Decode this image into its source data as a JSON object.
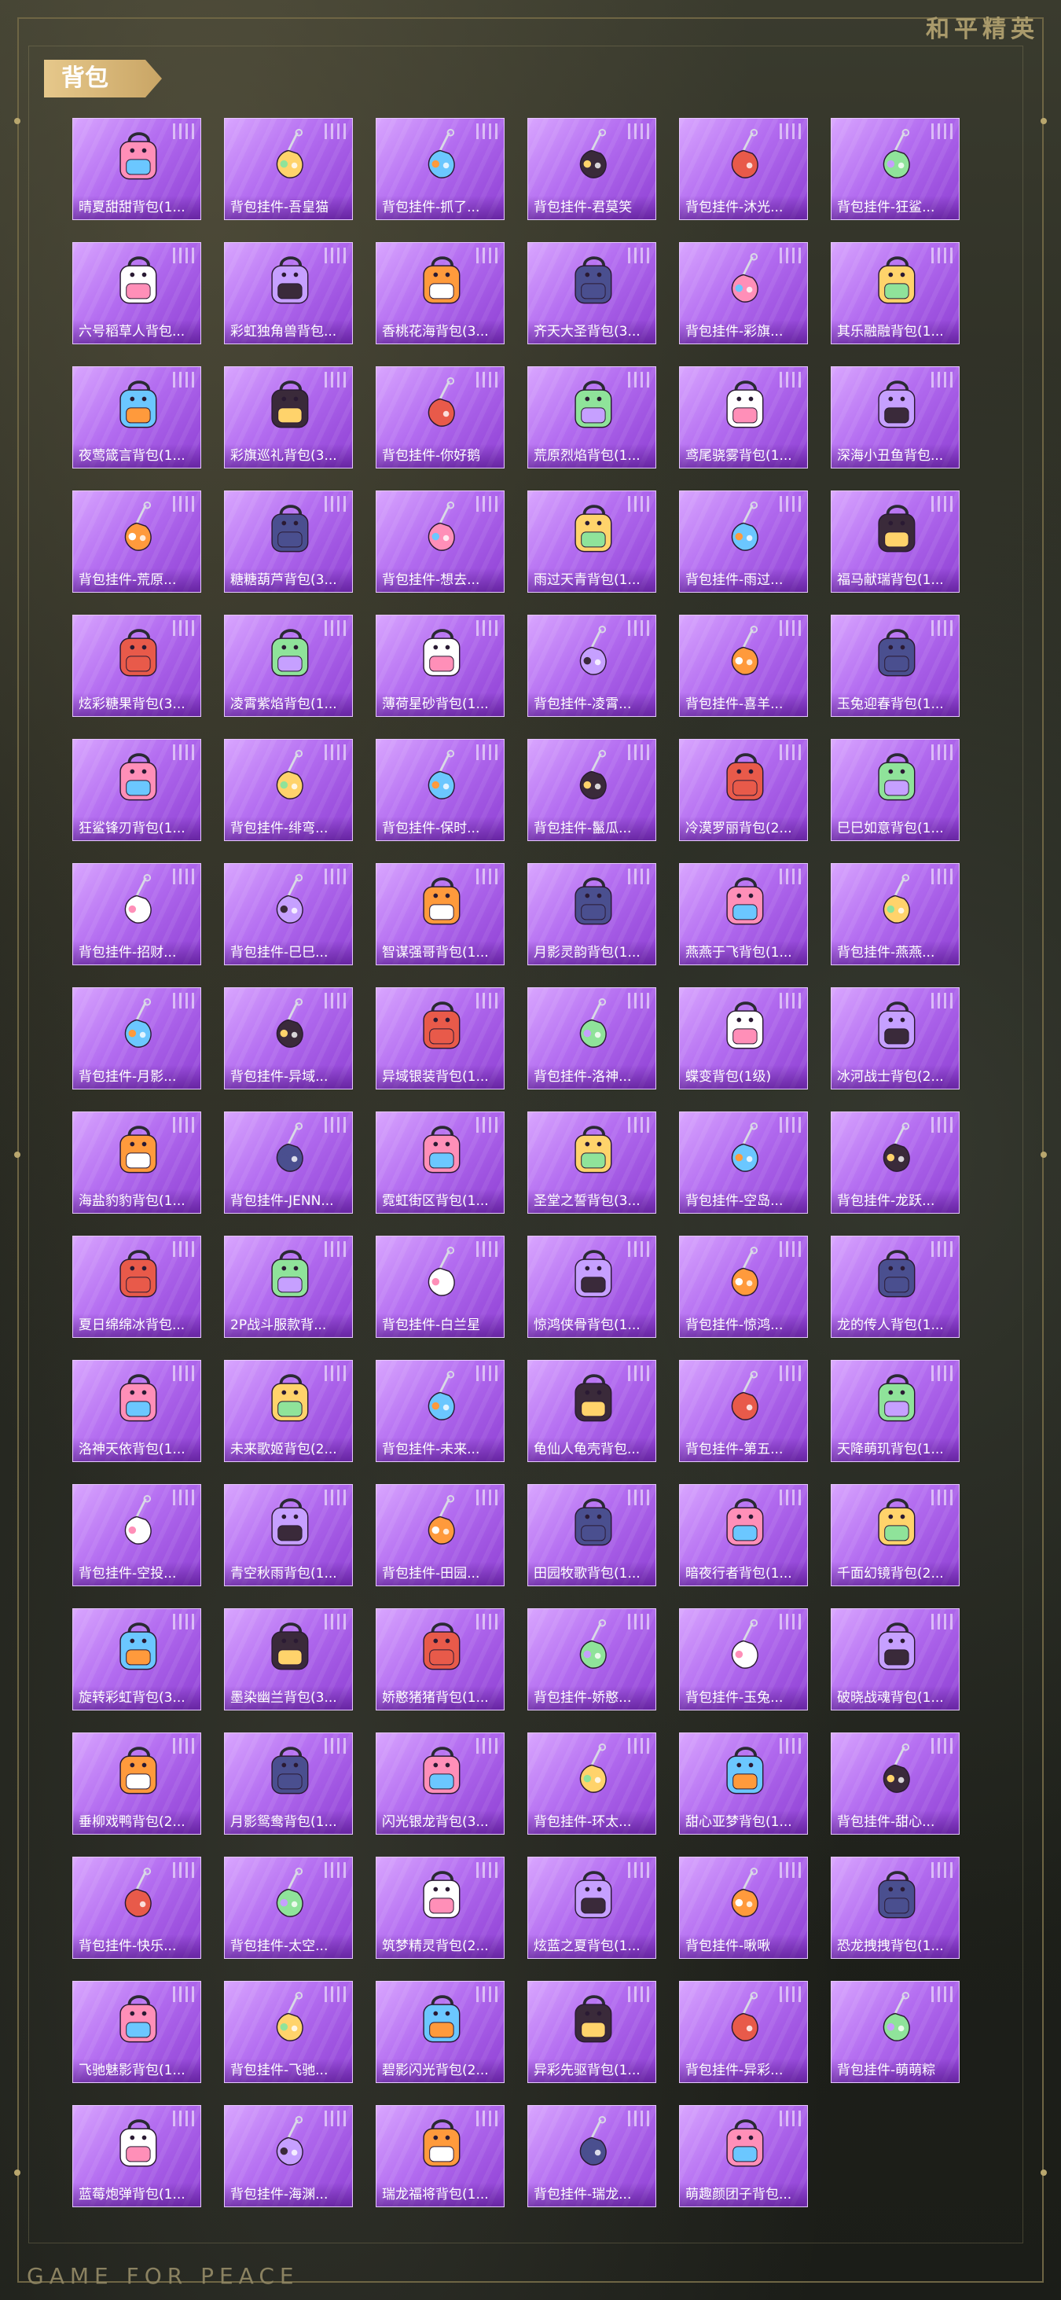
{
  "brand": "和平精英",
  "footer": "GAME FOR PEACE",
  "section_title": "背包",
  "items": [
    {
      "label": "晴夏甜甜背包(1...",
      "icon": "backpack-icon"
    },
    {
      "label": "背包挂件-吾皇猫",
      "icon": "charm-icon"
    },
    {
      "label": "背包挂件-抓了...",
      "icon": "charm-icon"
    },
    {
      "label": "背包挂件-君莫笑",
      "icon": "charm-icon"
    },
    {
      "label": "背包挂件-沐光...",
      "icon": "charm-icon"
    },
    {
      "label": "背包挂件-狂鲨...",
      "icon": "charm-icon"
    },
    {
      "label": "六号稻草人背包...",
      "icon": "backpack-icon"
    },
    {
      "label": "彩虹独角兽背包...",
      "icon": "backpack-icon"
    },
    {
      "label": "香桃花海背包(3...",
      "icon": "backpack-icon"
    },
    {
      "label": "齐天大圣背包(3...",
      "icon": "backpack-icon"
    },
    {
      "label": "背包挂件-彩旗...",
      "icon": "charm-icon"
    },
    {
      "label": "其乐融融背包(1...",
      "icon": "backpack-icon"
    },
    {
      "label": "夜莺箴言背包(1...",
      "icon": "backpack-icon"
    },
    {
      "label": "彩旗巡礼背包(3...",
      "icon": "backpack-icon"
    },
    {
      "label": "背包挂件-你好鹅",
      "icon": "charm-icon"
    },
    {
      "label": "荒原烈焰背包(1...",
      "icon": "backpack-icon"
    },
    {
      "label": "鸢尾骁雾背包(1...",
      "icon": "backpack-icon"
    },
    {
      "label": "深海小丑鱼背包...",
      "icon": "backpack-icon"
    },
    {
      "label": "背包挂件-荒原...",
      "icon": "charm-icon"
    },
    {
      "label": "糖糖葫芦背包(3...",
      "icon": "backpack-icon"
    },
    {
      "label": "背包挂件-想去...",
      "icon": "charm-icon"
    },
    {
      "label": "雨过天青背包(1...",
      "icon": "backpack-icon"
    },
    {
      "label": "背包挂件-雨过...",
      "icon": "charm-icon"
    },
    {
      "label": "福马献瑞背包(1...",
      "icon": "backpack-icon"
    },
    {
      "label": "炫彩糖果背包(3...",
      "icon": "backpack-icon"
    },
    {
      "label": "凌霄紫焰背包(1...",
      "icon": "backpack-icon"
    },
    {
      "label": "薄荷星砂背包(1...",
      "icon": "backpack-icon"
    },
    {
      "label": "背包挂件-凌霄...",
      "icon": "charm-icon"
    },
    {
      "label": "背包挂件-喜羊...",
      "icon": "charm-icon"
    },
    {
      "label": "玉兔迎春背包(1...",
      "icon": "backpack-icon"
    },
    {
      "label": "狂鲨锋刃背包(1...",
      "icon": "backpack-icon"
    },
    {
      "label": "背包挂件-绯弯...",
      "icon": "charm-icon"
    },
    {
      "label": "背包挂件-保时...",
      "icon": "charm-icon"
    },
    {
      "label": "背包挂件-鬣瓜...",
      "icon": "charm-icon"
    },
    {
      "label": "冷漠罗丽背包(2...",
      "icon": "backpack-icon"
    },
    {
      "label": "巳巳如意背包(1...",
      "icon": "backpack-icon"
    },
    {
      "label": "背包挂件-招财...",
      "icon": "charm-icon"
    },
    {
      "label": "背包挂件-巳巳...",
      "icon": "charm-icon"
    },
    {
      "label": "智谋强哥背包(1...",
      "icon": "backpack-icon"
    },
    {
      "label": "月影灵韵背包(1...",
      "icon": "backpack-icon"
    },
    {
      "label": "燕燕于飞背包(1...",
      "icon": "backpack-icon"
    },
    {
      "label": "背包挂件-燕燕...",
      "icon": "charm-icon"
    },
    {
      "label": "背包挂件-月影...",
      "icon": "charm-icon"
    },
    {
      "label": "背包挂件-异域...",
      "icon": "charm-icon"
    },
    {
      "label": "异域银装背包(1...",
      "icon": "backpack-icon"
    },
    {
      "label": "背包挂件-洛神...",
      "icon": "charm-icon"
    },
    {
      "label": "蝶变背包(1级)",
      "icon": "backpack-icon"
    },
    {
      "label": "冰河战士背包(2...",
      "icon": "backpack-icon"
    },
    {
      "label": "海盐豹豹背包(1...",
      "icon": "backpack-icon"
    },
    {
      "label": "背包挂件-JENN...",
      "icon": "charm-icon"
    },
    {
      "label": "霓虹街区背包(1...",
      "icon": "backpack-icon"
    },
    {
      "label": "圣堂之誓背包(3...",
      "icon": "backpack-icon"
    },
    {
      "label": "背包挂件-空岛...",
      "icon": "charm-icon"
    },
    {
      "label": "背包挂件-龙跃...",
      "icon": "charm-icon"
    },
    {
      "label": "夏日绵绵冰背包...",
      "icon": "backpack-icon"
    },
    {
      "label": "2P战斗服款背...",
      "icon": "backpack-icon"
    },
    {
      "label": "背包挂件-白兰星",
      "icon": "charm-icon"
    },
    {
      "label": "惊鸿侠骨背包(1...",
      "icon": "backpack-icon"
    },
    {
      "label": "背包挂件-惊鸿...",
      "icon": "charm-icon"
    },
    {
      "label": "龙的传人背包(1...",
      "icon": "backpack-icon"
    },
    {
      "label": "洛神天依背包(1...",
      "icon": "backpack-icon"
    },
    {
      "label": "未来歌姬背包(2...",
      "icon": "backpack-icon"
    },
    {
      "label": "背包挂件-未来...",
      "icon": "charm-icon"
    },
    {
      "label": "龟仙人龟壳背包...",
      "icon": "backpack-icon"
    },
    {
      "label": "背包挂件-第五...",
      "icon": "charm-icon"
    },
    {
      "label": "天降萌玑背包(1...",
      "icon": "backpack-icon"
    },
    {
      "label": "背包挂件-空投...",
      "icon": "charm-icon"
    },
    {
      "label": "青空秋雨背包(1...",
      "icon": "backpack-icon"
    },
    {
      "label": "背包挂件-田园...",
      "icon": "charm-icon"
    },
    {
      "label": "田园牧歌背包(1...",
      "icon": "backpack-icon"
    },
    {
      "label": "暗夜行者背包(1...",
      "icon": "backpack-icon"
    },
    {
      "label": "千面幻镜背包(2...",
      "icon": "backpack-icon"
    },
    {
      "label": "旋转彩虹背包(3...",
      "icon": "backpack-icon"
    },
    {
      "label": "墨染幽兰背包(3...",
      "icon": "backpack-icon"
    },
    {
      "label": "娇憨猪猪背包(1...",
      "icon": "backpack-icon"
    },
    {
      "label": "背包挂件-娇憨...",
      "icon": "charm-icon"
    },
    {
      "label": "背包挂件-玉兔...",
      "icon": "charm-icon"
    },
    {
      "label": "破晓战魂背包(1...",
      "icon": "backpack-icon"
    },
    {
      "label": "垂柳戏鸭背包(2...",
      "icon": "backpack-icon"
    },
    {
      "label": "月影鸳鸯背包(1...",
      "icon": "backpack-icon"
    },
    {
      "label": "闪光银龙背包(3...",
      "icon": "backpack-icon"
    },
    {
      "label": "背包挂件-环太...",
      "icon": "charm-icon"
    },
    {
      "label": "甜心亚梦背包(1...",
      "icon": "backpack-icon"
    },
    {
      "label": "背包挂件-甜心...",
      "icon": "charm-icon"
    },
    {
      "label": "背包挂件-快乐...",
      "icon": "charm-icon"
    },
    {
      "label": "背包挂件-太空...",
      "icon": "charm-icon"
    },
    {
      "label": "筑梦精灵背包(2...",
      "icon": "backpack-icon"
    },
    {
      "label": "炫蓝之夏背包(1...",
      "icon": "backpack-icon"
    },
    {
      "label": "背包挂件-啾啾",
      "icon": "charm-icon"
    },
    {
      "label": "恐龙拽拽背包(1...",
      "icon": "backpack-icon"
    },
    {
      "label": "飞驰魅影背包(1...",
      "icon": "backpack-icon"
    },
    {
      "label": "背包挂件-飞驰...",
      "icon": "charm-icon"
    },
    {
      "label": "碧影闪光背包(2...",
      "icon": "backpack-icon"
    },
    {
      "label": "异彩先驱背包(1...",
      "icon": "backpack-icon"
    },
    {
      "label": "背包挂件-异彩...",
      "icon": "charm-icon"
    },
    {
      "label": "背包挂件-萌萌粽",
      "icon": "charm-icon"
    },
    {
      "label": "蓝莓炮弹背包(1...",
      "icon": "backpack-icon"
    },
    {
      "label": "背包挂件-海渊...",
      "icon": "charm-icon"
    },
    {
      "label": "瑞龙福将背包(1...",
      "icon": "backpack-icon"
    },
    {
      "label": "背包挂件-瑞龙...",
      "icon": "charm-icon"
    },
    {
      "label": "萌趣颜团子背包...",
      "icon": "backpack-icon"
    }
  ],
  "colors": {
    "card_light": "#d9a6ff",
    "card_dark": "#8e3fd3",
    "frame": "#6e6544",
    "tag": "#e6c88b"
  },
  "item_palette": [
    "#ff8fb8",
    "#ffd36b",
    "#6bc7ff",
    "#3a2a3a",
    "#e85a4a",
    "#8fe39a",
    "#ffffff",
    "#c6a0ff",
    "#ff9a3c",
    "#4a4f8f"
  ]
}
